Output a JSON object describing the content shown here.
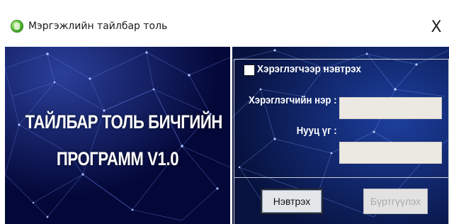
{
  "window": {
    "title": "Мэргэжлийн тайлбар толь",
    "close_glyph": "X",
    "app_icon": "app-logo-icon"
  },
  "banner": {
    "line1": "ТАЙЛБАР ТОЛЬ БИЧГИЙН",
    "line2": "ПРОГРАММ V1.0"
  },
  "login": {
    "user_login_checkbox_label": "Хэрэглэгчээр нэвтрэх",
    "user_login_checked": false,
    "username_label": "Хэрэглэгчийн нэр :",
    "username_value": "",
    "password_label": "Нууц үг :",
    "password_value": "",
    "login_button": "Нэвтрэх",
    "register_button": "Бүртгүүлэх",
    "register_enabled": false
  },
  "colors": {
    "banner_bg": "#050a3f",
    "panel_bg": "#0a1a55",
    "field_bg": "#ece9e2",
    "text_light": "#ffffff"
  }
}
